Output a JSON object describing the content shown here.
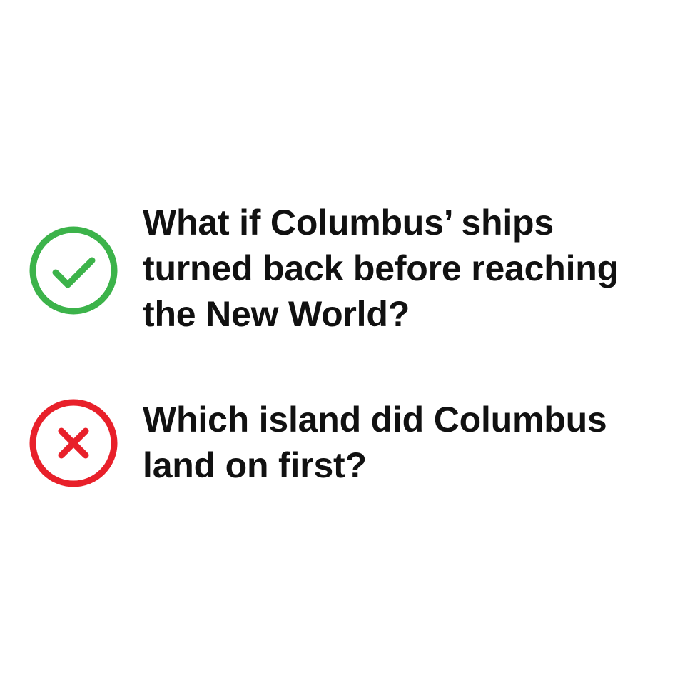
{
  "good_example": {
    "status": "correct",
    "icon": "check-circle-icon",
    "color": "#3cb34a",
    "lines": [
      "What if Columbus’ ships",
      "turned back before reaching",
      "the New World?"
    ]
  },
  "bad_example": {
    "status": "incorrect",
    "icon": "x-circle-icon",
    "color": "#e8202a",
    "lines": [
      "Which island did Columbus",
      "land on first?"
    ]
  }
}
